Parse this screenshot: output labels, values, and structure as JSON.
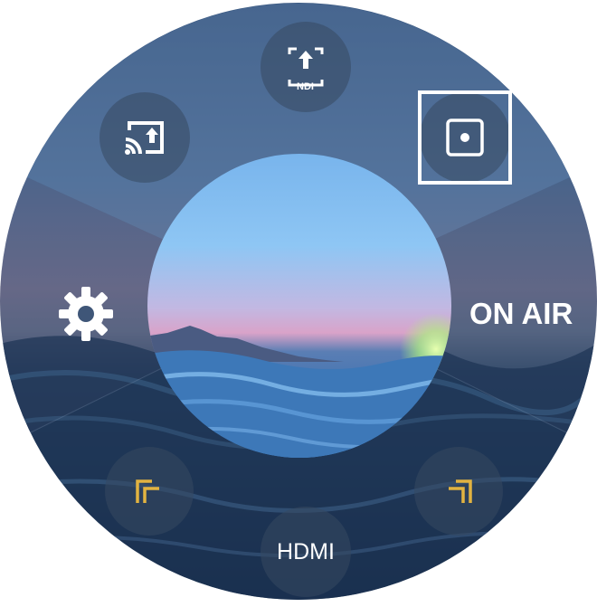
{
  "controls": {
    "on_air_label": "ON AIR",
    "hdmi_label": "HDMI",
    "ndi_badge": "NDI"
  },
  "icons": {
    "ndi_upload": "ndi-upload-icon",
    "cast": "cast-icon",
    "record": "record-icon",
    "settings": "gear-icon",
    "corner_top_left": "corner-bracket-icon",
    "corner_top_right": "corner-bracket-icon"
  },
  "colors": {
    "accent": "#e2b341",
    "focus": "#ffffff",
    "button_bg": "#374860"
  }
}
